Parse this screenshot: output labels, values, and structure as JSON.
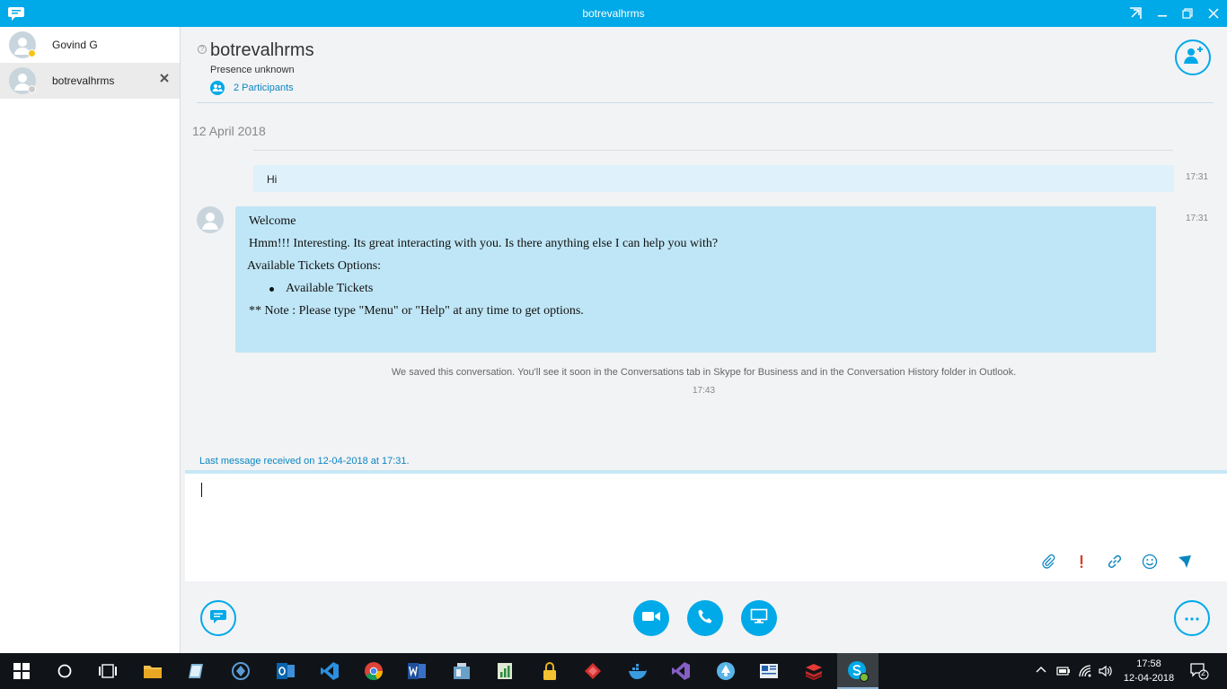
{
  "window": {
    "title": "botrevalhrms"
  },
  "sidebar": {
    "conversations": [
      {
        "name": "Govind G",
        "presence_color": "#f5c518"
      },
      {
        "name": "botrevalhrms",
        "presence_color": "#cccccc"
      }
    ]
  },
  "header": {
    "name": "botrevalhrms",
    "presence": "Presence unknown",
    "participants": "2 Participants"
  },
  "conversation": {
    "date": "12 April 2018",
    "messages": [
      {
        "text": "Hi",
        "time": "17:31"
      },
      {
        "time": "17:31",
        "lines": [
          "Welcome",
          "Hmm!!! Interesting. Its great interacting with you. Is there anything else I can help you with?",
          "Available Tickets Options:",
          "Available Tickets",
          "** Note : Please type \"Menu\" or \"Help\" at any time to get options."
        ]
      }
    ],
    "saved_note": "We saved this conversation. You'll see it soon in the Conversations tab in Skype for Business and in the Conversation History folder in Outlook.",
    "saved_time": "17:43",
    "last_message": "Last message received on 12-04-2018 at 17:31."
  },
  "taskbar": {
    "time": "17:58",
    "date": "12-04-2018",
    "notifications": "2"
  },
  "colors": {
    "accent": "#00a9e8",
    "bot_bubble": "#bfe6f6",
    "user_bubble": "#dff1fa",
    "link": "#0a86c1"
  }
}
